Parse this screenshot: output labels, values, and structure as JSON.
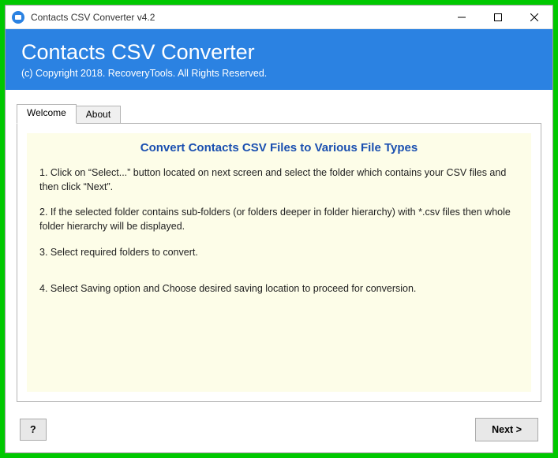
{
  "titlebar": {
    "title": "Contacts CSV Converter v4.2"
  },
  "header": {
    "title": "Contacts CSV Converter",
    "subtitle": "(c) Copyright 2018. RecoveryTools. All Rights Reserved."
  },
  "tabs": {
    "welcome": "Welcome",
    "about": "About"
  },
  "content": {
    "title": "Convert Contacts CSV Files to Various File Types",
    "step1": "1. Click on “Select...” button located on next screen and select the folder which contains your CSV files and then click “Next”.",
    "step2": "2. If the selected folder contains sub-folders (or folders deeper in folder hierarchy) with *.csv files then whole folder hierarchy will be displayed.",
    "step3": "3. Select required folders to convert.",
    "step4": "4. Select Saving option and Choose desired saving location to proceed for conversion."
  },
  "footer": {
    "help": "?",
    "next": "Next >"
  }
}
